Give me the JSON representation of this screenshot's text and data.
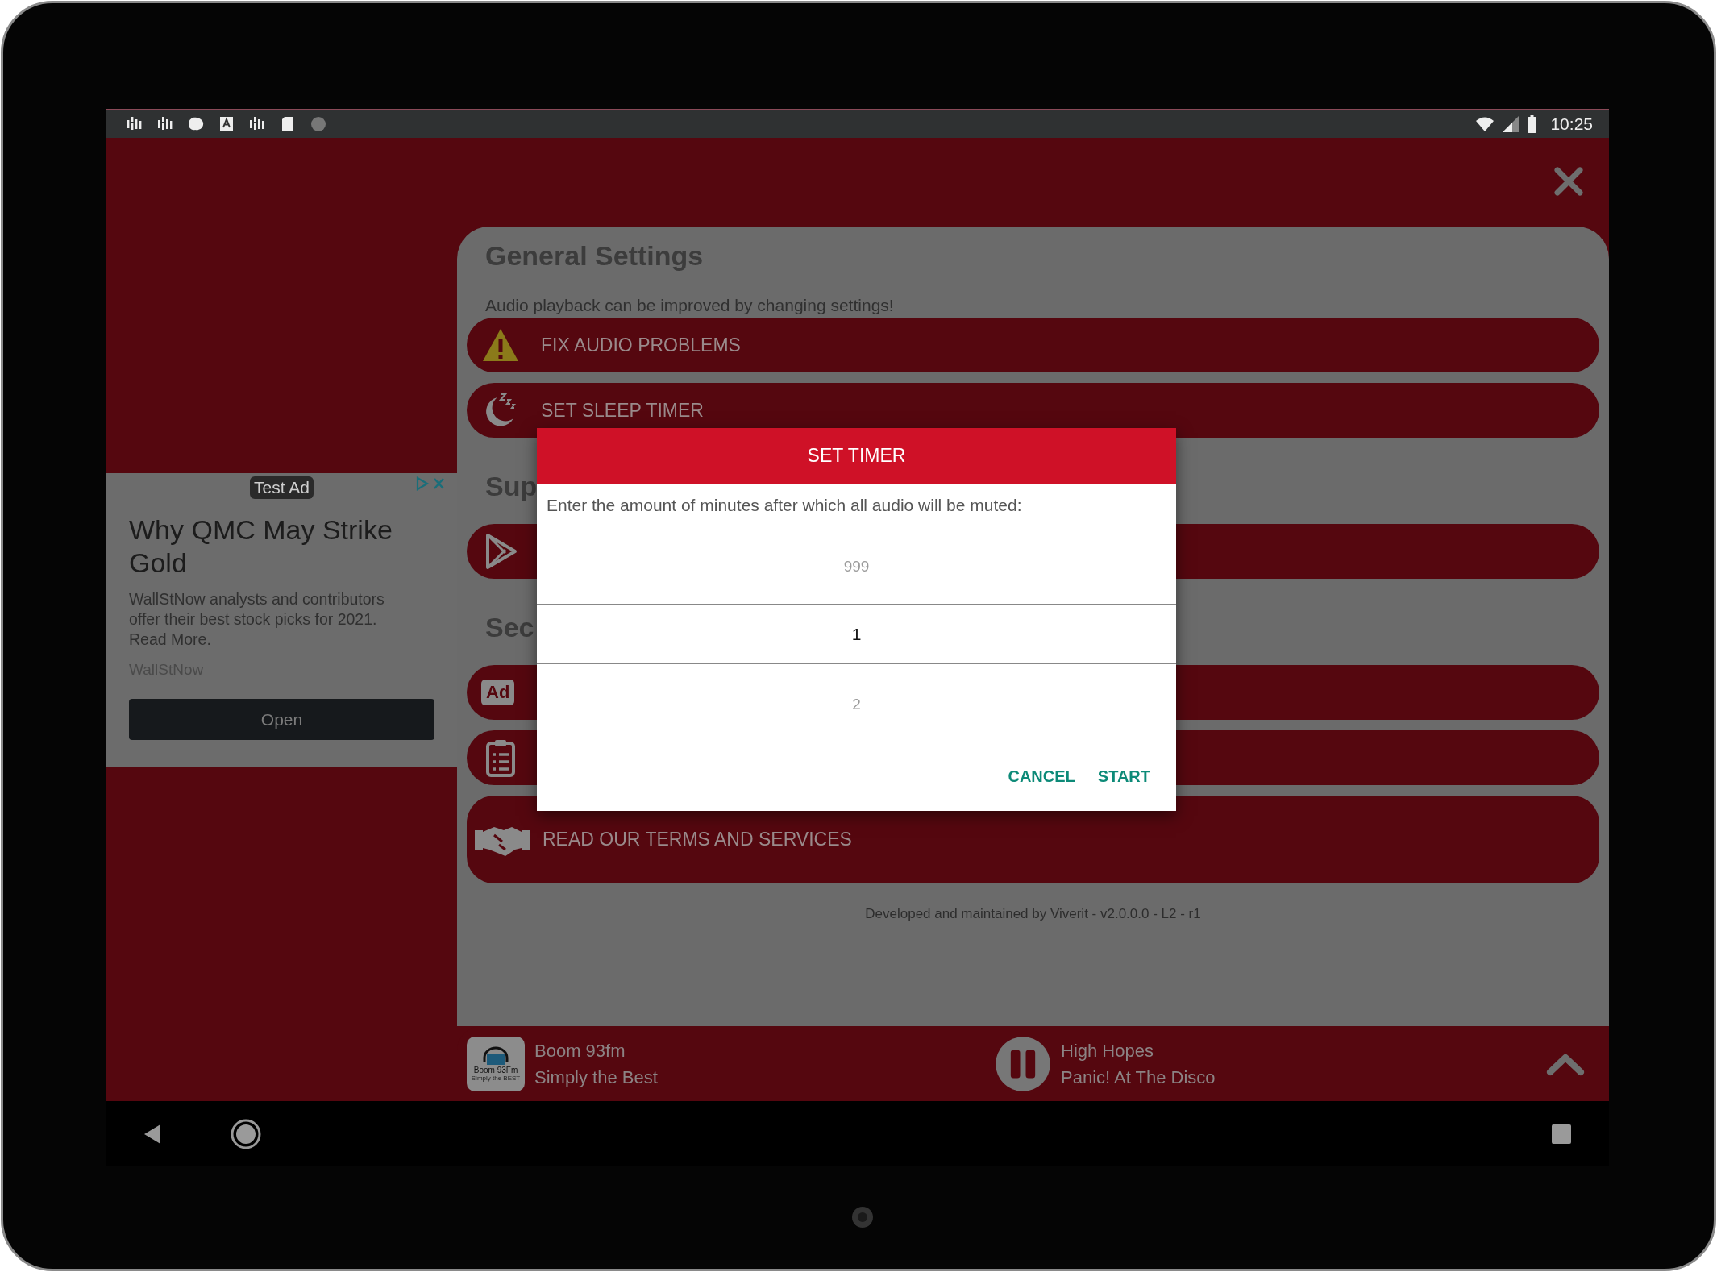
{
  "status_bar": {
    "time": "10:25"
  },
  "ad": {
    "badge": "Test Ad",
    "headline": "Why QMC May Strike Gold",
    "body": "WallStNow analysts and contributors offer their best stock picks for 2021. Read More.",
    "advertiser": "WallStNow",
    "button": "Open"
  },
  "settings": {
    "title": "General Settings",
    "subtitle": "Audio playback can be improved by changing settings!",
    "items": [
      {
        "kind": "warning",
        "label": "FIX AUDIO PROBLEMS"
      },
      {
        "kind": "sleep",
        "label": "SET SLEEP TIMER"
      },
      {
        "kind": "heading",
        "label": "Sup"
      },
      {
        "kind": "play"
      },
      {
        "kind": "heading",
        "label": "Sec"
      },
      {
        "kind": "ad",
        "icon_text": "Ad"
      },
      {
        "kind": "list"
      },
      {
        "kind": "terms",
        "label": "READ OUR TERMS AND SERVICES"
      }
    ],
    "footer": "Developed and maintained by Viverit - v2.0.0.0 - L2 - r1"
  },
  "player": {
    "logo_caption": "Boom 93Fm",
    "logo_tagline": "Simply the BEST",
    "station": "Boom 93fm",
    "slogan": "Simply the Best",
    "playing": true,
    "track": "High Hopes",
    "artist": "Panic! At The Disco"
  },
  "dialog": {
    "title": "SET TIMER",
    "message": "Enter the amount of minutes after which all audio will be muted:",
    "picker": [
      {
        "label": "999",
        "selected": false
      },
      {
        "label": "1",
        "selected": true
      },
      {
        "label": "2",
        "selected": false
      }
    ],
    "buttons": [
      "CANCEL",
      "START"
    ]
  }
}
